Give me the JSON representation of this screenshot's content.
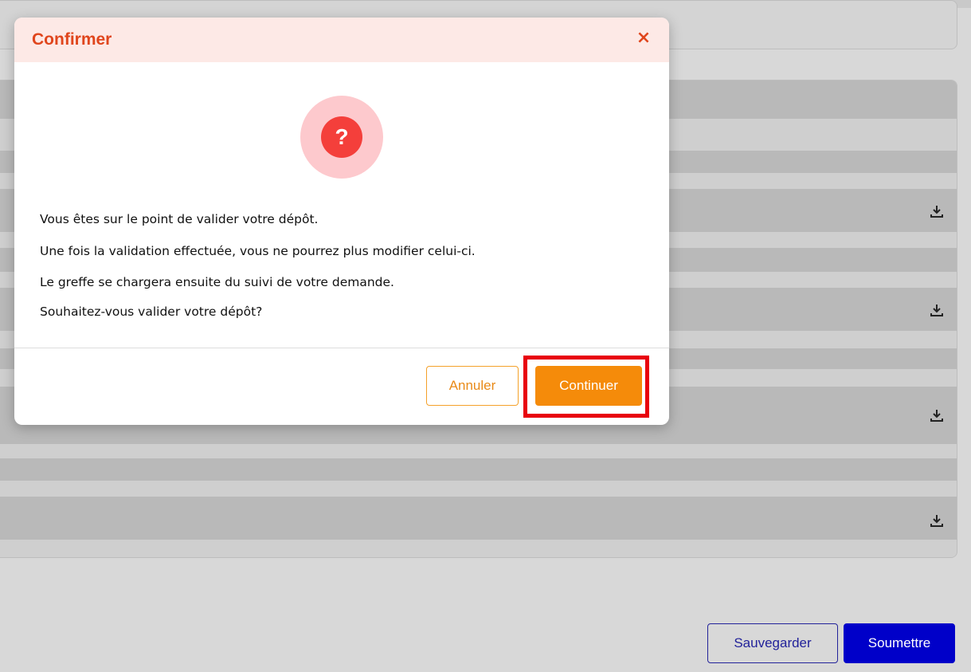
{
  "background": {
    "buttons": {
      "save_label": "Sauvegarder",
      "submit_label": "Soumettre"
    },
    "download_icon": "download-icon"
  },
  "modal": {
    "title": "Confirmer",
    "close_icon": "close-icon",
    "question_icon_glyph": "?",
    "message_lines": [
      "Vous êtes sur le point de valider votre dépôt.",
      "Une fois la validation effectuée, vous ne pourrez plus modifier celui-ci.",
      "Le greffe se chargera ensuite du suivi de votre demande.",
      "Souhaitez-vous valider votre dépôt?"
    ],
    "cancel_label": "Annuler",
    "continue_label": "Continuer"
  },
  "colors": {
    "title": "#e0461d",
    "header_bg": "#fde9e6",
    "question_outer": "#fdc9cd",
    "question_inner": "#f43f3b",
    "cancel_border": "#f4a12a",
    "continue_bg": "#f58b0a",
    "highlight": "#e8000d",
    "submit_bg": "#0000c9"
  }
}
